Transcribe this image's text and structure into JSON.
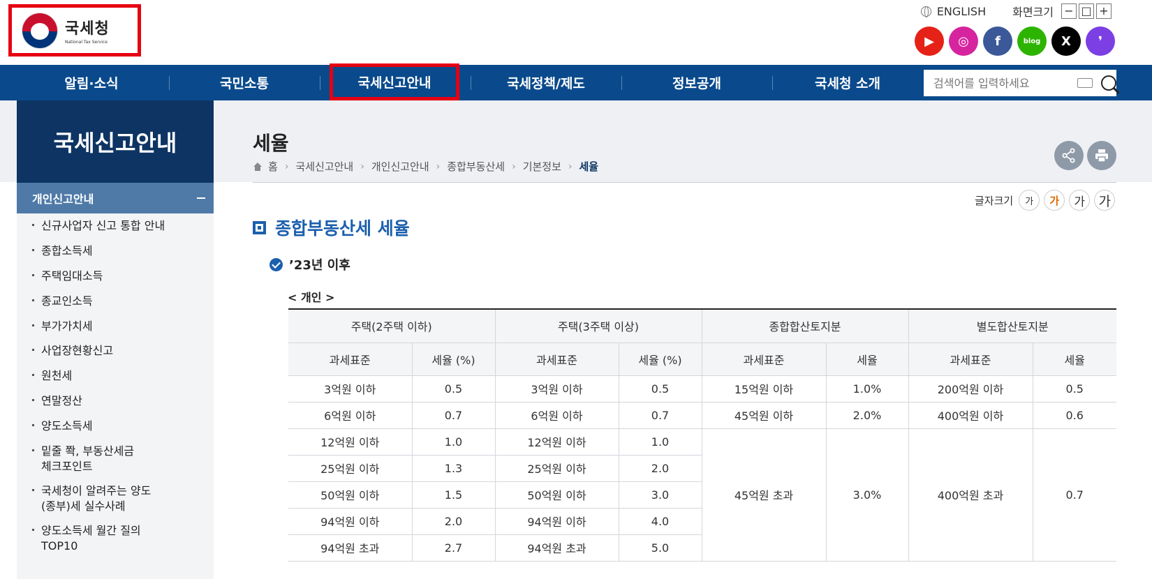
{
  "logo": {
    "name_ko": "국세청",
    "name_en": "National Tax Service"
  },
  "topbar": {
    "english": "ENGLISH",
    "zoom_label": "화면크기",
    "zoom_out": "−",
    "zoom_reset": "□",
    "zoom_in": "+"
  },
  "sns": [
    {
      "name": "youtube",
      "glyph": "▶",
      "color": "#e62117"
    },
    {
      "name": "instagram",
      "glyph": "◎",
      "color": "#d6249f"
    },
    {
      "name": "facebook",
      "glyph": "f",
      "color": "#3b5998"
    },
    {
      "name": "blog",
      "glyph": "blog",
      "color": "#2db400"
    },
    {
      "name": "x",
      "glyph": "X",
      "color": "#000000"
    },
    {
      "name": "kakao",
      "glyph": "❜",
      "color": "#7b3fe4"
    }
  ],
  "nav": {
    "items": [
      "알림·소식",
      "국민소통",
      "국세신고안내",
      "국세정책/제도",
      "정보공개",
      "국세청 소개"
    ],
    "search_placeholder": "검색어를 입력하세요"
  },
  "sidebar": {
    "title": "국세신고안내",
    "section": "개인신고안내",
    "items": [
      "신규사업자 신고 통합 안내",
      "종합소득세",
      "주택임대소득",
      "종교인소득",
      "부가가치세",
      "사업장현황신고",
      "원천세",
      "연말정산",
      "양도소득세",
      "밑줄 쫙, 부동산세금\n체크포인트",
      "국세청이 알려주는 양도\n(종부)세 실수사례",
      "양도소득세 월간 질의\nTOP10"
    ]
  },
  "page": {
    "title": "세율",
    "breadcrumb": [
      "홈",
      "국세신고안내",
      "개인신고안내",
      "종합부동산세",
      "기본정보",
      "세율"
    ],
    "font_size_label": "글자크기",
    "font_size_options": [
      "가",
      "가",
      "가",
      "가"
    ],
    "section_title": "종합부동산세 세율",
    "sub_title": "’23년 이후",
    "caption": "< 개인 >"
  },
  "table": {
    "groups": [
      "주택(2주택 이하)",
      "주택(3주택 이상)",
      "종합합산토지분",
      "별도합산토지분"
    ],
    "subheaders": [
      "과세표준",
      "세율 (%)",
      "과세표준",
      "세율 (%)",
      "과세표준",
      "세율",
      "과세표준",
      "세율"
    ],
    "house_rows": [
      [
        "3억원 이하",
        "0.5",
        "3억원 이하",
        "0.5"
      ],
      [
        "6억원 이하",
        "0.7",
        "6억원 이하",
        "0.7"
      ],
      [
        "12억원 이하",
        "1.0",
        "12억원 이하",
        "1.0"
      ],
      [
        "25억원 이하",
        "1.3",
        "25억원 이하",
        "2.0"
      ],
      [
        "50억원 이하",
        "1.5",
        "50억원 이하",
        "3.0"
      ],
      [
        "94억원 이하",
        "2.0",
        "94억원 이하",
        "4.0"
      ],
      [
        "94억원 초과",
        "2.7",
        "94억원 초과",
        "5.0"
      ]
    ],
    "land_rows": [
      [
        "15억원 이하",
        "1.0%",
        "200억원 이하",
        "0.5"
      ],
      [
        "45억원 이하",
        "2.0%",
        "400억원 이하",
        "0.6"
      ],
      [
        "45억원 초과",
        "3.0%",
        "400억원 초과",
        "0.7"
      ]
    ]
  }
}
